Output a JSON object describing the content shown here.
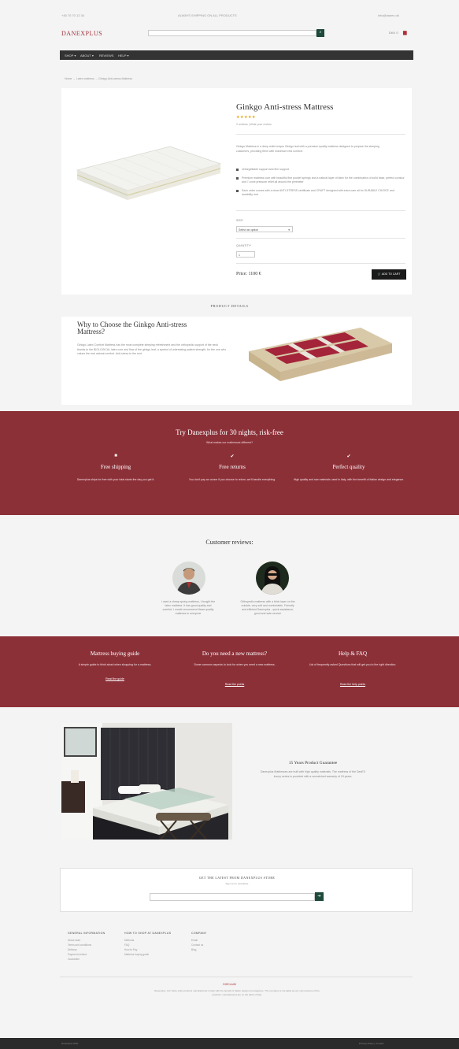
{
  "topbar": {
    "left": "+45 70 70 12 34",
    "center": "ALWAYS SHIPPING ON ALL PRODUCTS",
    "right": "info@danex.dk"
  },
  "header": {
    "logo": "DANEXPLUS",
    "cart": "DKK 0",
    "search_icon": "search-icon",
    "cart_icon": "cart-icon"
  },
  "nav": [
    "SHOP ▾",
    "ABOUT ▾",
    "REVIEWS",
    "HELP ▾"
  ],
  "breadcrumb": "Home  →  Latex mattress  →  Ginkgo Anti-stress Mattress",
  "product": {
    "title": "Ginkgo Anti-stress Mattress",
    "stars": "★★★★★",
    "reviews": "2 reviews | Write your review",
    "description": "Ginkgo Mattress in a deep relief unique Ginkgo leaf with a premium quality mattress designed to prepare the sleeping customers, providing them with maximum rest comfort.",
    "bullets": [
      "Unforgettable support and firm support",
      "Premium mattress core with beautiful fine pocket springs and a natural layer of latex for the combination of solid base, perfect contour and 7-zone pressure relief all around the perimeter",
      "Each order comes with a clear ANTI-STRESS certificate and CRAFT designed with extra care all for DURABLE CHOICE and durability rest"
    ],
    "size_label": "SIZE*",
    "size_value": "Select an option",
    "qty_label": "QUANTITY*",
    "qty_value": "1",
    "price": "Price: 1100 €",
    "add_to_cart": "ADD TO CART"
  },
  "details_heading": "PRODUCT DETAILS",
  "why": {
    "title": "Why to Choose the Ginkgo Anti-stress Mattress?",
    "text": "Ginkgo Latex Comfort Mattress has the most complete sleeping refreshment and the orthopedic support of the neck thanks to the BIOLOGICAL latex core and flow of the ginkgo leaf, a symbol of unbreaking patient strength, for the one who values the real natural comfort. Anti-stress to the end."
  },
  "trial": {
    "title": "Try Danexplus for 30 nights, risk-free",
    "sub": "What makes our mattresses different?",
    "features": [
      {
        "icon": "■",
        "title": "Free shipping",
        "text": "Danexplus ships for free with your total starts the day you get it."
      },
      {
        "icon": "✔",
        "title": "Free returns",
        "text": "You don't pay an ounce if you choose to return, we'll handle everything."
      },
      {
        "icon": "✔",
        "title": "Perfect quality",
        "text": "High quality and raw materials used in Italy, with the benefit of Italian design and elegance."
      }
    ]
  },
  "customer_reviews": {
    "title": "Customer reviews:",
    "items": [
      {
        "text": "I used a cheap spring mattress, I bought the latex mattress. It has good quality and comfort, I would recommend these quality mattress to everyone"
      },
      {
        "text": "Orthopedic mattress with a thick layer on the outside, very soft and comfortable. Friendly and efficient Danexplus - quick assistance, good and safe service"
      }
    ]
  },
  "guides": [
    {
      "title": "Mattress buying guide",
      "text": "A simple guide to think about when shopping for a mattress.",
      "link": "Read the guide"
    },
    {
      "title": "Do you need a new mattress?",
      "text": "Some common aspects to look for when you need a new mattress.",
      "link": "Read the points"
    },
    {
      "title": "Help & FAQ",
      "text": "List of frequently asked Questions that will get you to the right direction.",
      "link": "Read the help points"
    }
  ],
  "guarantee": {
    "title": "15 Years Product Guarantee",
    "text": "Danexplus Mattresses are built with high quality materials. The mattress of the DanEX luxury series is provided with a unmatched warranty of 15 years."
  },
  "newsletter": {
    "title": "GET THE LATEST FROM DANEXPLUS STORE",
    "sub": "Sign up for newsletter",
    "button": "➔"
  },
  "footer": {
    "columns": [
      {
        "head": "GENERAL INFORMATION",
        "links": [
          "About store",
          "Terms and conditions",
          "Delivery",
          "Payment method",
          "Guarantee"
        ]
      },
      {
        "head": "HOW TO SHOP AT DANEXPLUS",
        "links": [
          "Methods",
          "FAQ",
          "How to Pay",
          "Mattress buying guide"
        ]
      },
      {
        "head": "COMPANY",
        "links": [
          "Email",
          "Contact us",
          "Blog"
        ]
      }
    ],
    "disclaimer_title": "DISCLAIM",
    "disclaimer_text": "Danexplus. Our Store sells products manufactured in Italy with the benefit of Italian design and elegance. The company is not liable as our only partners of the products. manufactured are on the table of Italy.",
    "bottom_left": "Danexplus 2021",
    "bottom_right": "Privacy Policy | Contact"
  },
  "colors": {
    "brand_red": "#8c3038",
    "accent_green": "#1e4a3a",
    "dark": "#333333"
  }
}
